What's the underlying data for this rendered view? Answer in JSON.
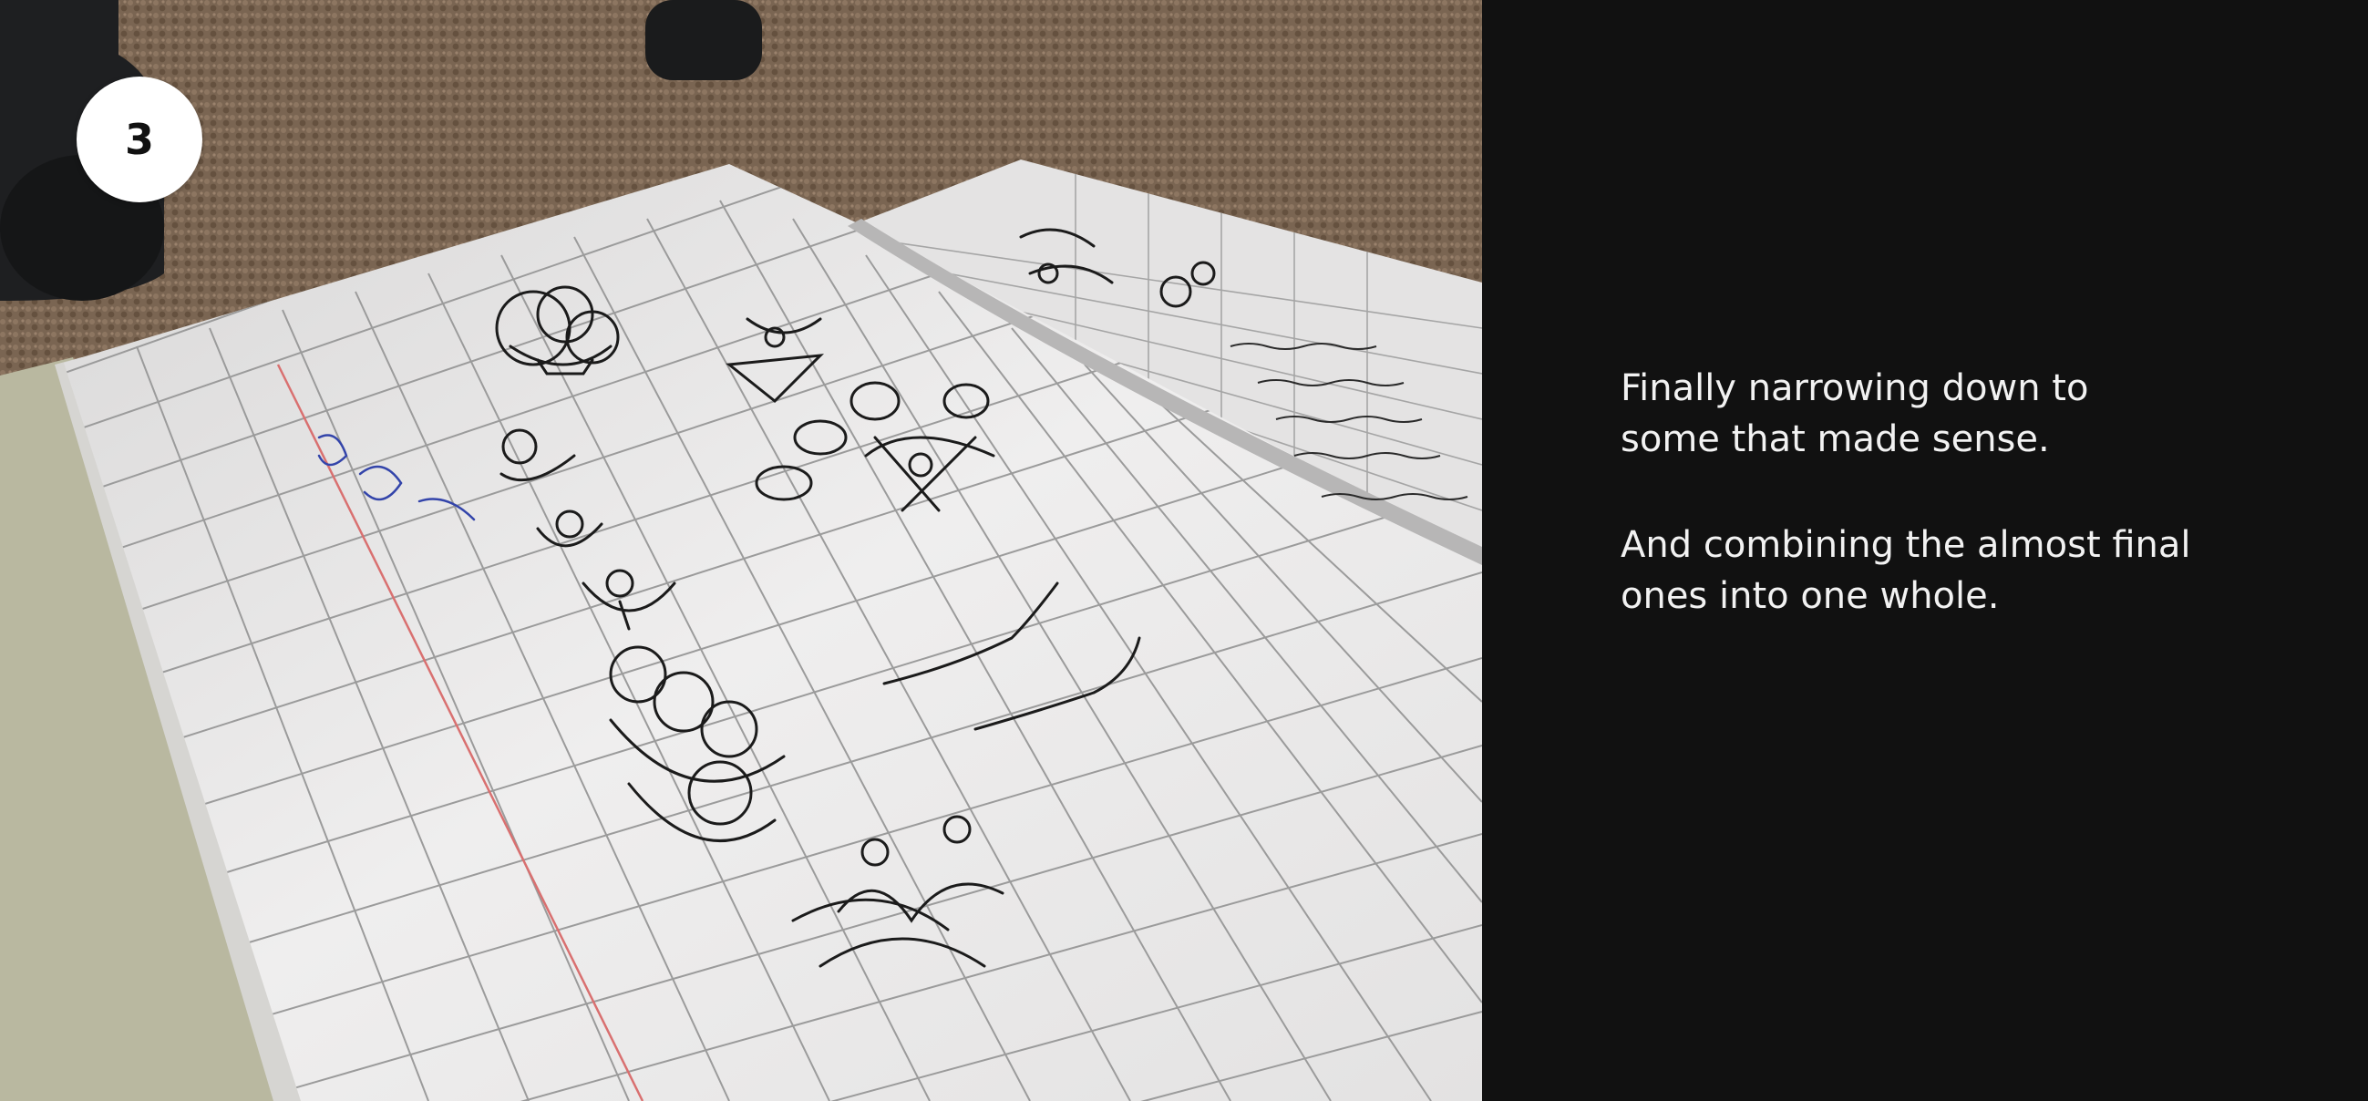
{
  "slide": {
    "step_number": "3",
    "caption_paragraphs": [
      "Finally narrowing down to\nsome that made sense.",
      "And combining the almost final\nones into one whole."
    ]
  },
  "photo": {
    "subject": "open grid-paper sketchbook with pen sketches on carpet",
    "icon": "photo-image"
  },
  "colors": {
    "background": "#111111",
    "text": "#f2f2f2",
    "badge": "#ffffff",
    "carpet": "#7a6552",
    "paper": "#ecebeb"
  }
}
